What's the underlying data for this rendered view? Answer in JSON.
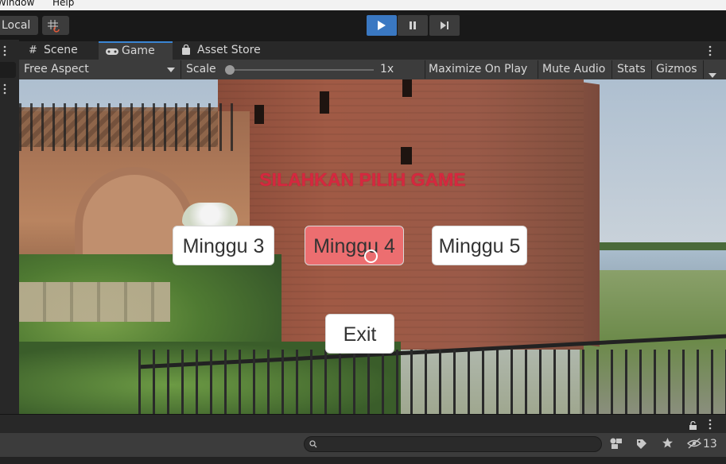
{
  "menubar": {
    "items": [
      "Window",
      "Help"
    ]
  },
  "toolbar": {
    "pivot_label": "Local",
    "play_active": true
  },
  "tabs": [
    {
      "label": "Scene",
      "icon": "grid-icon",
      "active": false
    },
    {
      "label": "Game",
      "icon": "gamepad-icon",
      "active": true
    },
    {
      "label": "Asset Store",
      "icon": "bag-icon",
      "active": false
    }
  ],
  "game_toolbar": {
    "aspect": "Free Aspect",
    "scale_label": "Scale",
    "scale_value": "1x",
    "maximize": "Maximize On Play",
    "mute": "Mute Audio",
    "stats": "Stats",
    "gizmos": "Gizmos"
  },
  "game": {
    "title": "SILAHKAN PILIH GAME",
    "buttons": [
      "Minggu 3",
      "Minggu 4",
      "Minggu 5"
    ],
    "hovered_button": "Minggu 4",
    "exit": "Exit",
    "colors": {
      "title": "#d5283f",
      "hover": "#ec6e70",
      "button": "#ffffff"
    }
  },
  "bottom": {
    "search_placeholder": "",
    "hidden_count": "13"
  }
}
